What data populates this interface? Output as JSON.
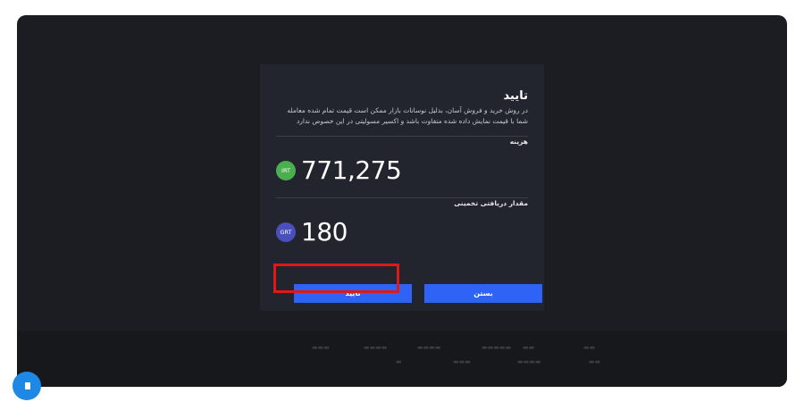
{
  "modal": {
    "title": "تایید",
    "description": "در روش خرید و فروش آسان، بدلیل نوسانات بازار ممکن است قیمت تمام شده معامله شما با قیمت نمایش داده شده متفاوت باشد و اکسیر مسولیتی در این خصوص ندارد",
    "cost": {
      "label": "هزینه",
      "currency": "IRT",
      "amount": "771,275"
    },
    "receive": {
      "label": "مقدار دریافتی تخمینی",
      "currency": "GRT",
      "amount": "180"
    },
    "buttons": {
      "confirm": "تایید",
      "close": "بستن"
    }
  },
  "colors": {
    "page_background": "#1c1d22",
    "modal_background": "#23252e",
    "button": "#2e63f5",
    "irt_coin": "#4bae4f",
    "grt_coin": "#4a4fbd",
    "highlight": "#e01818"
  }
}
